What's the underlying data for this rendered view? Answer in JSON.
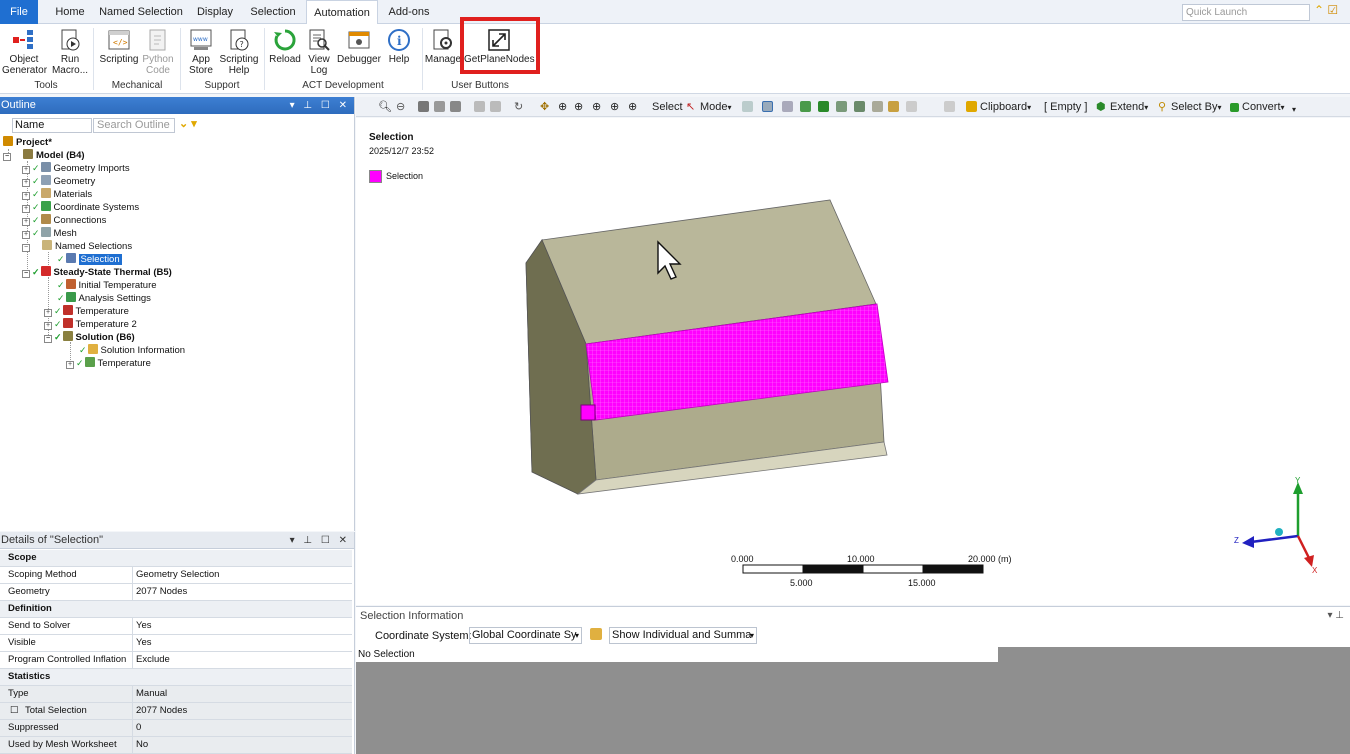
{
  "tabs": [
    "File",
    "Home",
    "Named Selection",
    "Display",
    "Selection",
    "Automation",
    "Add-ons"
  ],
  "active_tab": "Automation",
  "quick_launch_placeholder": "Quick Launch",
  "ribbon": {
    "object_generator": "Object\nGenerator",
    "run_macro": "Run\nMacro...",
    "scripting": "Scripting",
    "python_code": "Python\nCode",
    "app_store": "App\nStore",
    "scripting_help": "Scripting\nHelp",
    "reload": "Reload",
    "view_log": "View\nLog",
    "debugger": "Debugger",
    "help": "Help",
    "manage": "Manage",
    "get_plane_nodes": "GetPlaneNodes",
    "groups": {
      "tools": "Tools",
      "mechanical": "Mechanical",
      "support": "Support",
      "act": "ACT Development",
      "user": "User Buttons"
    }
  },
  "outline": {
    "title": "Outline",
    "name_label": "Name",
    "search_placeholder": "Search Outline",
    "tree": {
      "project": "Project*",
      "model": "Model (B4)",
      "geometry_imports": "Geometry Imports",
      "geometry": "Geometry",
      "materials": "Materials",
      "coordinate_systems": "Coordinate Systems",
      "connections": "Connections",
      "mesh": "Mesh",
      "named_selections": "Named Selections",
      "selection": "Selection",
      "steady_state": "Steady-State Thermal (B5)",
      "initial_temperature": "Initial Temperature",
      "analysis_settings": "Analysis Settings",
      "temperature": "Temperature",
      "temperature2": "Temperature 2",
      "solution": "Solution (B6)",
      "solution_info": "Solution Information",
      "sol_temperature": "Temperature"
    }
  },
  "details": {
    "title": "Details of \"Selection\"",
    "scope": "Scope",
    "scoping_method_k": "Scoping Method",
    "scoping_method_v": "Geometry Selection",
    "geometry_k": "Geometry",
    "geometry_v": "2077 Nodes",
    "definition": "Definition",
    "send_to_solver_k": "Send to Solver",
    "send_to_solver_v": "Yes",
    "visible_k": "Visible",
    "visible_v": "Yes",
    "pci_k": "Program Controlled Inflation",
    "pci_v": "Exclude",
    "statistics": "Statistics",
    "type_k": "Type",
    "type_v": "Manual",
    "total_selection_k": "Total Selection",
    "total_selection_v": "2077 Nodes",
    "suppressed_k": "Suppressed",
    "suppressed_v": "0",
    "used_by_mesh_k": "Used by Mesh Worksheet",
    "used_by_mesh_v": "No"
  },
  "graphics_toolbar": {
    "select": "Select",
    "mode": "Mode",
    "clipboard": "Clipboard",
    "empty": "[ Empty ]",
    "extend": "Extend",
    "select_by": "Select By",
    "convert": "Convert"
  },
  "viewport": {
    "title": "Selection",
    "date": "2025/12/7 23:52",
    "legend_label": "Selection",
    "legend_color": "#ff00ff",
    "scale": {
      "t0": "0.000",
      "t10": "10.000",
      "t20": "20.000 (m)",
      "t5": "5.000",
      "t15": "15.000"
    },
    "triad": {
      "x": "X",
      "y": "Y",
      "z": "Z"
    }
  },
  "selection_info": {
    "title": "Selection Information",
    "coord_label": "Coordinate System:",
    "coord_value": "Global Coordinate Sy",
    "show_value": "Show Individual and Summa",
    "status": "No Selection"
  },
  "colors": {
    "accent": "#1f6fd1",
    "highlight_box": "#e0201e",
    "body": "#b9b79a",
    "selection": "#ff00ff"
  }
}
